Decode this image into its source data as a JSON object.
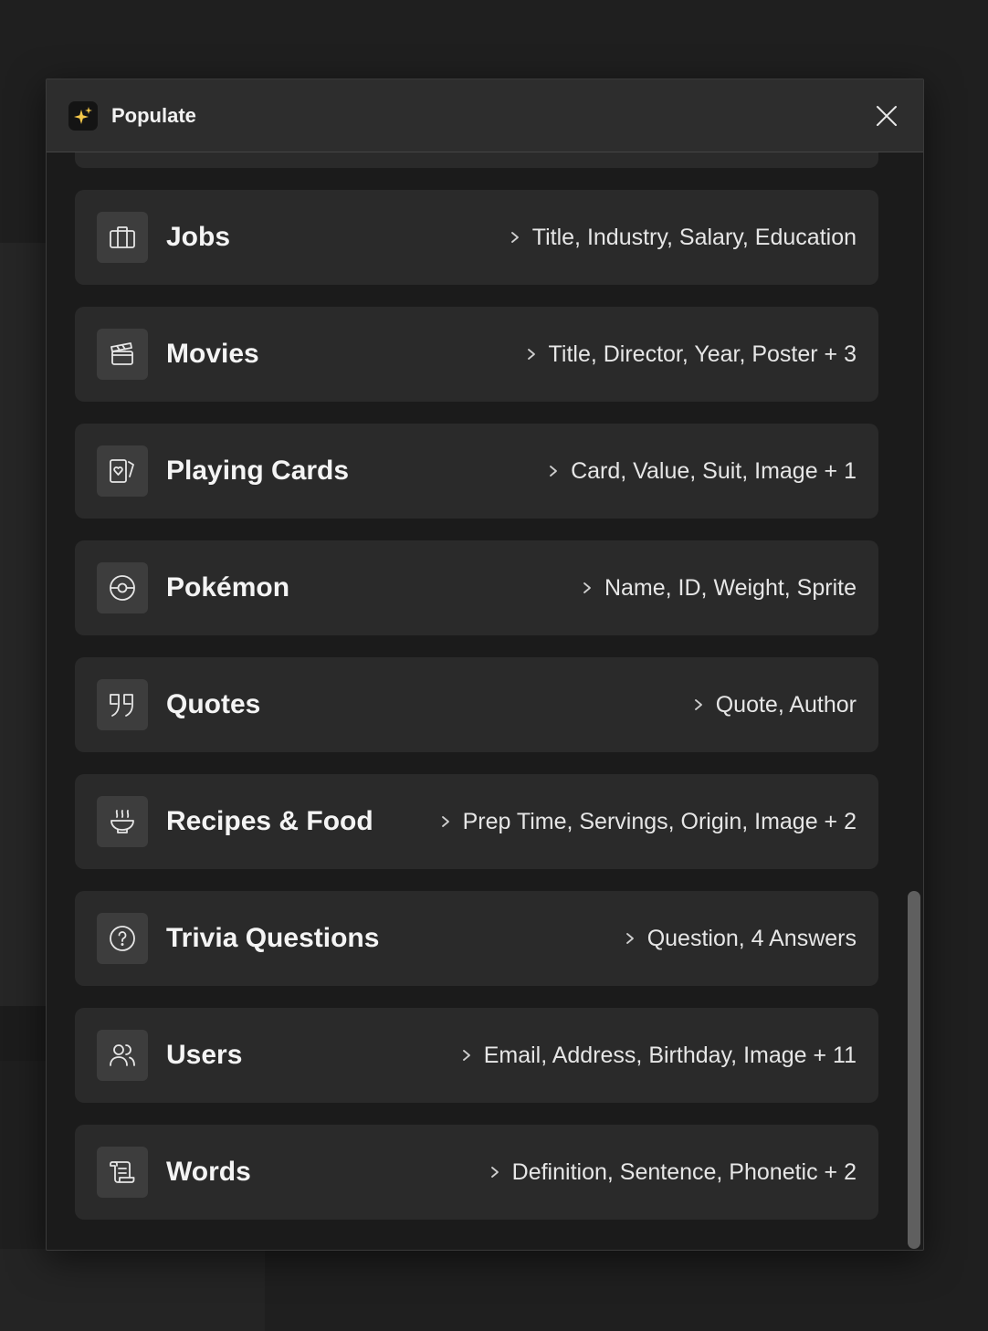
{
  "dialog": {
    "title": "Populate",
    "app_icon": "sparkle-icon",
    "close_icon": "close-icon"
  },
  "items": [
    {
      "name": "Jobs",
      "fields": "Title, Industry, Salary, Education",
      "icon": "briefcase-icon"
    },
    {
      "name": "Movies",
      "fields": "Title, Director, Year, Poster + 3",
      "icon": "clapperboard-icon"
    },
    {
      "name": "Playing Cards",
      "fields": "Card, Value, Suit, Image + 1",
      "icon": "cards-icon"
    },
    {
      "name": "Pokémon",
      "fields": "Name, ID, Weight, Sprite",
      "icon": "pokeball-icon"
    },
    {
      "name": "Quotes",
      "fields": "Quote, Author",
      "icon": "quote-icon"
    },
    {
      "name": "Recipes & Food",
      "fields": "Prep Time, Servings, Origin, Image + 2",
      "icon": "soup-bowl-icon"
    },
    {
      "name": "Trivia Questions",
      "fields": "Question, 4 Answers",
      "icon": "help-circle-icon"
    },
    {
      "name": "Users",
      "fields": "Email, Address, Birthday, Image + 11",
      "icon": "users-icon"
    },
    {
      "name": "Words",
      "fields": "Definition, Sentence, Phonetic + 2",
      "icon": "scroll-icon"
    }
  ],
  "colors": {
    "background": "#1f1f1f",
    "header": "#2d2d2d",
    "card": "#2a2a2a",
    "icon_tile": "#3d3d3d",
    "sparkle": "#f5c84a"
  }
}
